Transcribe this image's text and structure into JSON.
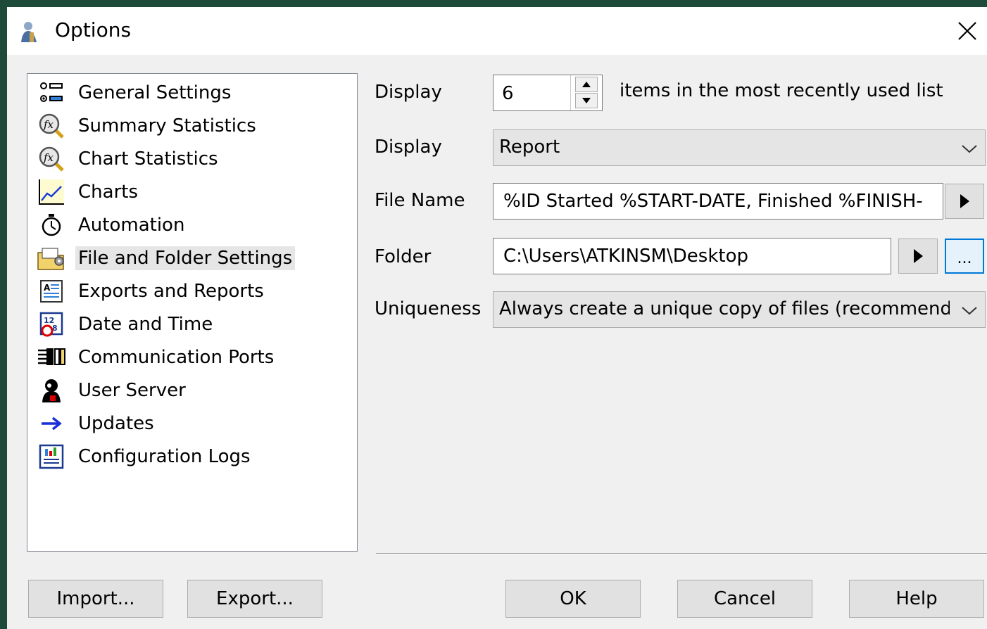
{
  "window": {
    "title": "Options"
  },
  "colors": {
    "accent": "#0078d7",
    "titlebar": "#ffffff",
    "frame": "#1e4a3a",
    "dialog": "#f0f0f0"
  },
  "tree": {
    "items": [
      {
        "label": "General Settings",
        "icon": "settings-list-icon"
      },
      {
        "label": "Summary Statistics",
        "icon": "function-magnifier-icon"
      },
      {
        "label": "Chart Statistics",
        "icon": "function-magnifier-icon"
      },
      {
        "label": "Charts",
        "icon": "line-chart-icon"
      },
      {
        "label": "Automation",
        "icon": "stopwatch-icon"
      },
      {
        "label": "File and Folder Settings",
        "icon": "folder-settings-icon",
        "selected": true
      },
      {
        "label": "Exports and Reports",
        "icon": "report-icon"
      },
      {
        "label": "Date and Time",
        "icon": "calendar-clock-icon"
      },
      {
        "label": "Communication Ports",
        "icon": "ports-icon"
      },
      {
        "label": "User Server",
        "icon": "user-server-icon"
      },
      {
        "label": "Updates",
        "icon": "arrow-right-icon"
      },
      {
        "label": "Configuration Logs",
        "icon": "config-log-icon"
      }
    ]
  },
  "settings": {
    "mru": {
      "label": "Display",
      "value": "6",
      "suffix": "items in the most recently used list"
    },
    "display": {
      "label": "Display",
      "value": "Report"
    },
    "file_name": {
      "label": "File Name",
      "value": "%ID Started %START-DATE, Finished %FINISH-"
    },
    "folder": {
      "label": "Folder",
      "value": "C:\\Users\\ATKINSM\\Desktop",
      "browse_label": "..."
    },
    "uniqueness": {
      "label": "Uniqueness",
      "value": "Always create a unique copy of files (recommendec"
    }
  },
  "buttons": {
    "import": "Import...",
    "export": "Export...",
    "ok": "OK",
    "cancel": "Cancel",
    "help": "Help"
  }
}
